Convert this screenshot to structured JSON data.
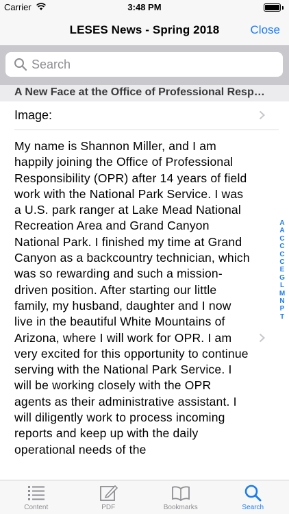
{
  "status_bar": {
    "carrier": "Carrier",
    "time": "3:48 PM",
    "battery_level": 1.0
  },
  "nav": {
    "title": "LESES News - Spring 2018",
    "close_label": "Close"
  },
  "search": {
    "placeholder": "Search"
  },
  "section": {
    "header": "A New Face at the Office of Professional Responsibility"
  },
  "rows": {
    "image_label": "Image:",
    "body": "My name is Shannon Miller, and I am happily joining the Office of Professional Responsibility (OPR) after 14 years of field work with the National Park Service. I was a U.S. park ranger at Lake Mead National Recreation Area and Grand Canyon National Park. I finished my time at Grand Canyon as a backcountry technician, which was so rewarding and such a mission-driven position. After starting our little family, my husband, daughter and I now live in the beautiful White Mountains of Arizona, where I will work for OPR. I am very excited for this opportunity to continue serving with the National Park Service. I will be working closely with the OPR agents as their administrative assistant. I will diligently work to process incoming reports and keep up with the daily operational needs of the"
  },
  "index": [
    "A",
    "A",
    "C",
    "C",
    "C",
    "C",
    "E",
    "G",
    "L",
    "M",
    "N",
    "P",
    "T"
  ],
  "tabs": [
    {
      "label": "Content",
      "icon": "list-icon",
      "active": false
    },
    {
      "label": "PDF",
      "icon": "pencil-square-icon",
      "active": false
    },
    {
      "label": "Bookmarks",
      "icon": "book-icon",
      "active": false
    },
    {
      "label": "Search",
      "icon": "search-icon",
      "active": true
    }
  ],
  "colors": {
    "accent": "#1a7cf5",
    "inactive": "#8e8e93",
    "search_area": "#c8c8cd"
  }
}
